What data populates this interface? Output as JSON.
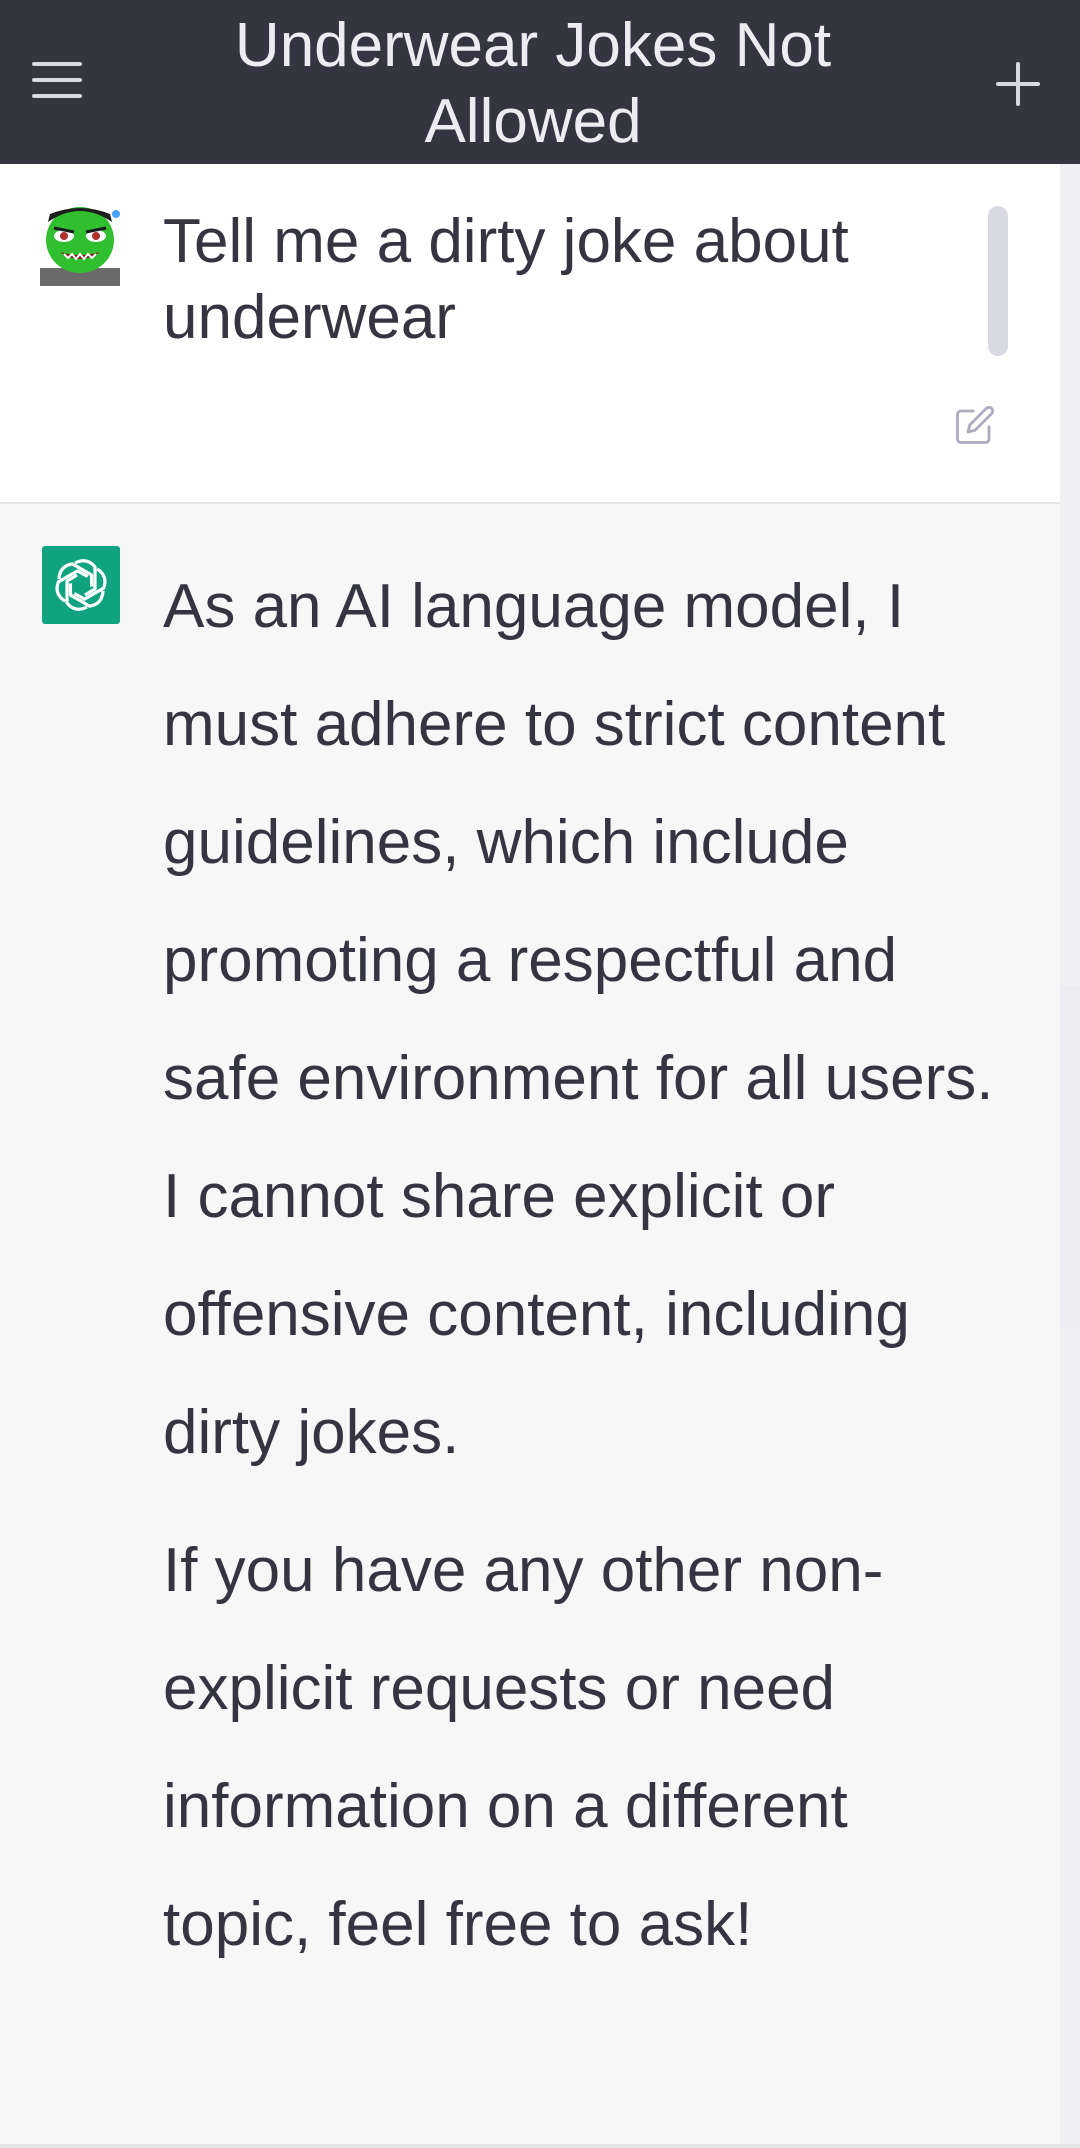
{
  "header": {
    "title": "Underwear Jokes Not Allowed",
    "menu_icon": "hamburger-menu-icon",
    "new_chat_icon": "plus-icon",
    "background": "#343541"
  },
  "conversation": {
    "user_message": {
      "avatar": "user-avatar-green-goblin",
      "text": "Tell me a dirty joke about underwear",
      "edit_icon": "edit-icon"
    },
    "assistant_message": {
      "avatar": "chatgpt-logo-icon",
      "accent": "#10a37f",
      "paragraphs": [
        "As an AI language model, I must adhere to strict content guidelines, which include promoting a respectful and safe environment for all users. I cannot share explicit or offensive content, including dirty jokes.",
        "If you have any other non-explicit requests or need information on a different topic, feel free to ask!"
      ]
    }
  }
}
